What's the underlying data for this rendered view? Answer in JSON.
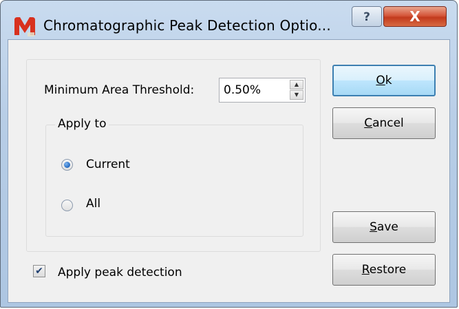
{
  "window": {
    "title": "Chromatographic Peak Detection Optio...",
    "help_glyph": "?",
    "close_glyph": "X"
  },
  "threshold": {
    "label": "Minimum Area Threshold:",
    "value": "0.50%",
    "up_glyph": "▲",
    "down_glyph": "▼"
  },
  "apply_to": {
    "legend": "Apply to",
    "options": [
      {
        "label": "Current",
        "selected": true
      },
      {
        "label": "All",
        "selected": false
      }
    ]
  },
  "apply_peak_detection": {
    "label": "Apply peak detection",
    "checked": true,
    "check_glyph": "✔"
  },
  "buttons": {
    "ok": {
      "mnemonic": "O",
      "rest": "k"
    },
    "cancel": {
      "mnemonic": "C",
      "rest": "ancel"
    },
    "save": {
      "mnemonic": "S",
      "rest": "ave"
    },
    "restore": {
      "mnemonic": "R",
      "rest": "estore"
    }
  },
  "icons": {
    "app": "app-logo-icon",
    "help": "help-icon",
    "close": "close-icon"
  },
  "colors": {
    "titlebar": "#b7cde6",
    "close": "#c23a1d",
    "radio_selected": "#2f73c8",
    "default_button_border": "#3c7fb1"
  }
}
